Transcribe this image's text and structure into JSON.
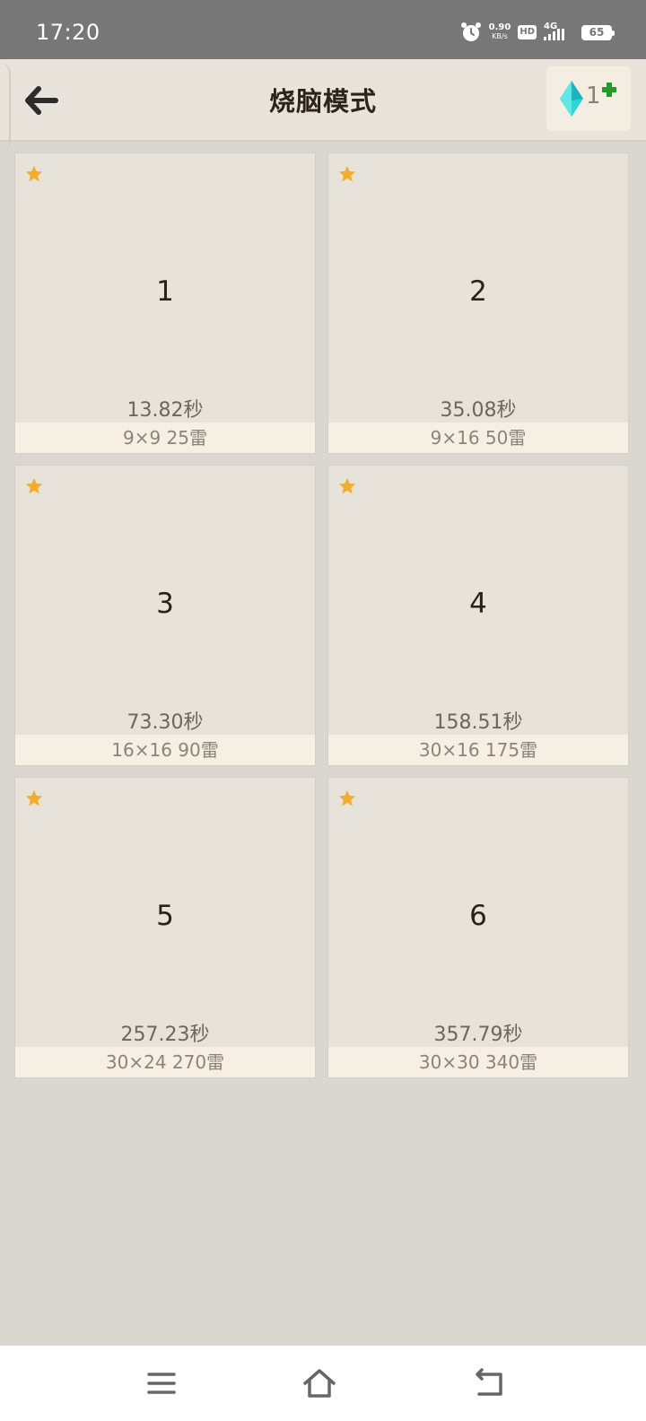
{
  "status_bar": {
    "time": "17:20",
    "net_speed_value": "0.90",
    "net_speed_unit": "KB/s",
    "hd_label": "HD",
    "network_type": "4G",
    "battery_level": "65"
  },
  "header": {
    "title": "烧脑模式",
    "gem_count": "1",
    "icons": [
      "back-arrow-icon",
      "gem-icon",
      "plus-icon"
    ],
    "gem_color": "#2fd4d8",
    "plus_color": "#249a2b"
  },
  "levels": [
    {
      "number": "1",
      "best_time": "13.82秒",
      "info": "9×9  25雷",
      "starred": true
    },
    {
      "number": "2",
      "best_time": "35.08秒",
      "info": "9×16  50雷",
      "starred": true
    },
    {
      "number": "3",
      "best_time": "73.30秒",
      "info": "16×16  90雷",
      "starred": true
    },
    {
      "number": "4",
      "best_time": "158.51秒",
      "info": "30×16  175雷",
      "starred": true
    },
    {
      "number": "5",
      "best_time": "257.23秒",
      "info": "30×24  270雷",
      "starred": true
    },
    {
      "number": "6",
      "best_time": "357.79秒",
      "info": "30×30  340雷",
      "starred": true
    }
  ],
  "star_color": "#f2ad2c",
  "nav_bar": {
    "icons": [
      "menu-icon",
      "home-icon",
      "back-icon"
    ]
  }
}
